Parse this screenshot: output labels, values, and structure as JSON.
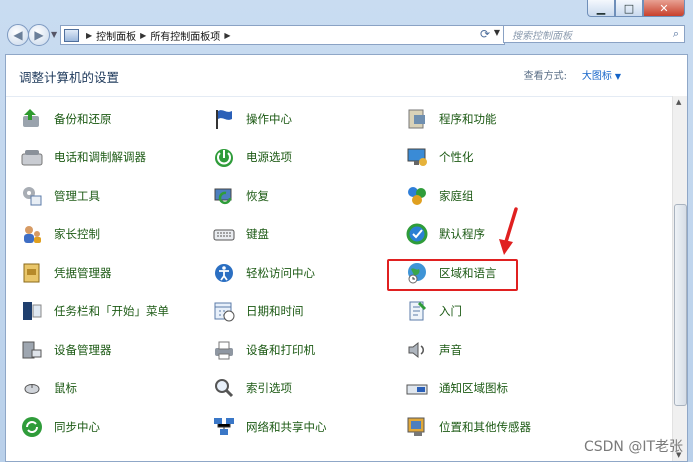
{
  "window": {
    "minimize_label": "▁",
    "maximize_label": "□",
    "close_label": "✕"
  },
  "nav": {
    "back_label": "◀",
    "forward_label": "▶",
    "breadcrumb": [
      "控制面板",
      "所有控制面板项"
    ],
    "search_placeholder": "搜索控制面板"
  },
  "header": {
    "title": "调整计算机的设置",
    "view_by_label": "查看方式:",
    "view_by_value": "大图标"
  },
  "items": [
    {
      "label": "备份和还原",
      "icon": "backup-icon"
    },
    {
      "label": "操作中心",
      "icon": "action-center-flag-icon"
    },
    {
      "label": "程序和功能",
      "icon": "programs-icon"
    },
    {
      "label": "电话和调制解调器",
      "icon": "phone-icon"
    },
    {
      "label": "电源选项",
      "icon": "power-icon"
    },
    {
      "label": "个性化",
      "icon": "personalization-icon"
    },
    {
      "label": "管理工具",
      "icon": "admin-tools-icon"
    },
    {
      "label": "恢复",
      "icon": "recovery-icon"
    },
    {
      "label": "家庭组",
      "icon": "homegroup-icon"
    },
    {
      "label": "家长控制",
      "icon": "parental-controls-icon"
    },
    {
      "label": "键盘",
      "icon": "keyboard-icon"
    },
    {
      "label": "默认程序",
      "icon": "default-programs-icon"
    },
    {
      "label": "凭据管理器",
      "icon": "credential-manager-icon"
    },
    {
      "label": "轻松访问中心",
      "icon": "ease-of-access-icon"
    },
    {
      "label": "区域和语言",
      "icon": "region-language-globe-icon"
    },
    {
      "label": "任务栏和「开始」菜单",
      "icon": "taskbar-icon"
    },
    {
      "label": "日期和时间",
      "icon": "date-time-icon"
    },
    {
      "label": "入门",
      "icon": "getting-started-icon"
    },
    {
      "label": "设备管理器",
      "icon": "device-manager-icon"
    },
    {
      "label": "设备和打印机",
      "icon": "printer-icon"
    },
    {
      "label": "声音",
      "icon": "sound-icon"
    },
    {
      "label": "鼠标",
      "icon": "mouse-icon"
    },
    {
      "label": "索引选项",
      "icon": "indexing-icon"
    },
    {
      "label": "通知区域图标",
      "icon": "notification-icon"
    },
    {
      "label": "同步中心",
      "icon": "sync-icon"
    },
    {
      "label": "网络和共享中心",
      "icon": "network-icon"
    },
    {
      "label": "位置和其他传感器",
      "icon": "location-sensor-icon"
    }
  ],
  "annotation": {
    "highlighted_item": "区域和语言",
    "highlight_color": "#e02020"
  },
  "watermark": "CSDN @IT老张",
  "colors": {
    "link_green": "#1c5a14",
    "title_blue": "#1e395b",
    "view_link": "#1464c8"
  }
}
